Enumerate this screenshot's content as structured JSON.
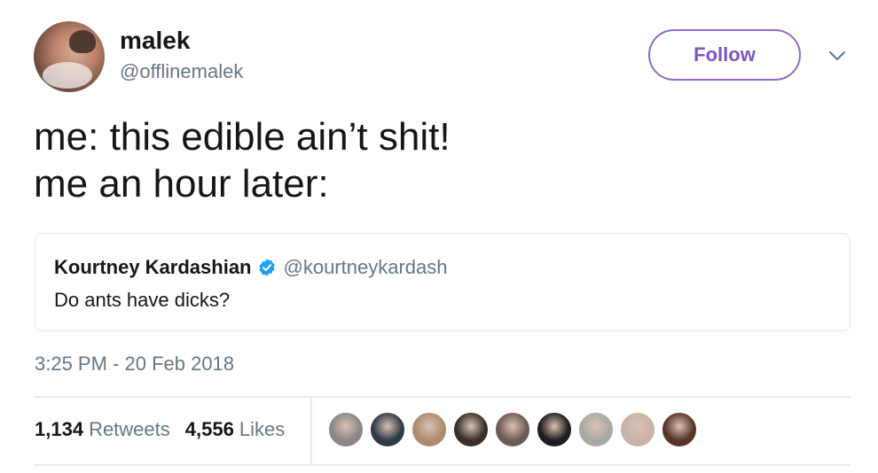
{
  "author": {
    "display_name": "malek",
    "handle": "@offlinemalek"
  },
  "follow_label": "Follow",
  "tweet_text_lines": [
    "me: this edible ain’t shit!",
    "me an hour later:"
  ],
  "quoted_tweet": {
    "display_name": "Kourtney Kardashian",
    "handle": "@kourtneykardash",
    "text": "Do ants have dicks?"
  },
  "timestamp": "3:25 PM - 20 Feb 2018",
  "stats": {
    "retweets_count": "1,134",
    "retweets_label": "Retweets",
    "likes_count": "4,556",
    "likes_label": "Likes"
  },
  "liker_avatar_colors": [
    "#8a8785",
    "#2f3a45",
    "#b08a6e",
    "#3a2e2a",
    "#6e5a55",
    "#1f1d1c",
    "#a7aaa4",
    "#c9b2a6",
    "#5a3428"
  ],
  "colors": {
    "follow_accent": "#7b55c2",
    "verified_blue": "#1da1f2",
    "secondary_text": "#657786"
  }
}
